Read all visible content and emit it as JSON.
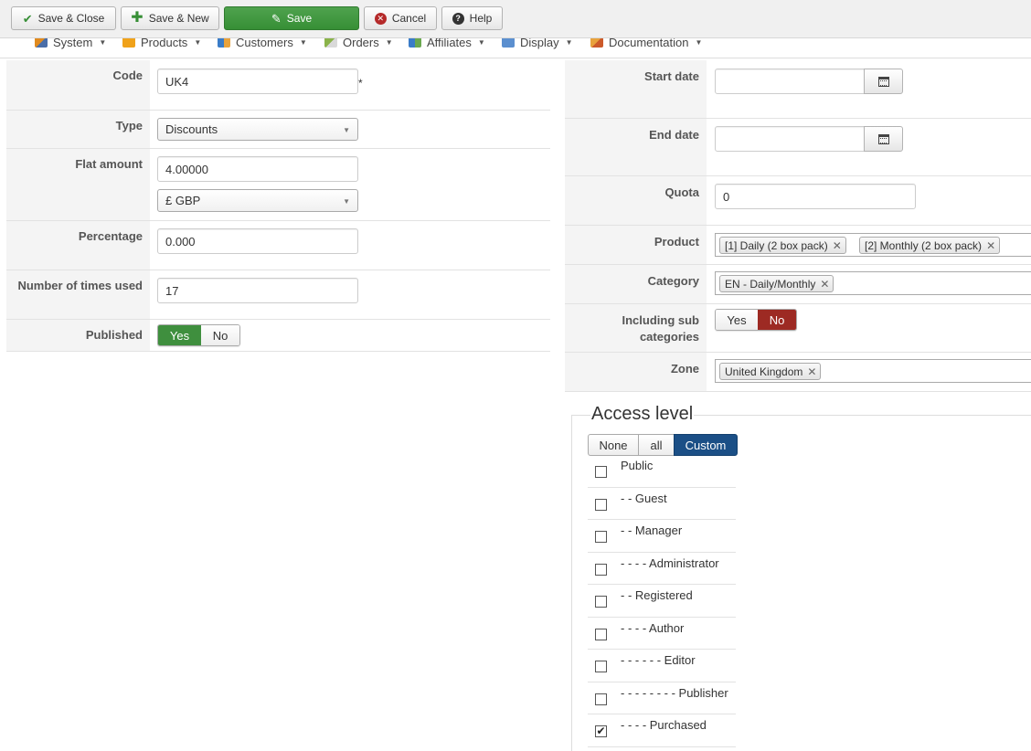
{
  "toolbar": {
    "save_close": "Save & Close",
    "save_new": "Save & New",
    "save": "Save",
    "cancel": "Cancel",
    "help": "Help"
  },
  "menu": {
    "items": [
      {
        "label": "System",
        "icon": "wrench-icon"
      },
      {
        "label": "Products",
        "icon": "box-icon"
      },
      {
        "label": "Customers",
        "icon": "users-icon"
      },
      {
        "label": "Orders",
        "icon": "orders-icon"
      },
      {
        "label": "Affiliates",
        "icon": "affiliates-icon"
      },
      {
        "label": "Display",
        "icon": "display-icon"
      },
      {
        "label": "Documentation",
        "icon": "documentation-icon"
      }
    ]
  },
  "form_left": {
    "code_label": "Code",
    "code_value": "UK4",
    "required_mark": "*",
    "type_label": "Type",
    "type_value": "Discounts",
    "flat_amount_label": "Flat amount",
    "flat_amount_value": "4.00000",
    "currency_value": "£ GBP",
    "percentage_label": "Percentage",
    "percentage_value": "0.000",
    "times_used_label": "Number of times used",
    "times_used_value": "17",
    "published_label": "Published",
    "yes": "Yes",
    "no": "No",
    "published_selected": "Yes"
  },
  "form_right": {
    "start_date_label": "Start date",
    "start_date_value": "",
    "end_date_label": "End date",
    "end_date_value": "",
    "quota_label": "Quota",
    "quota_value": "0",
    "product_label": "Product",
    "products": [
      "[1] Daily (2 box pack)",
      "[2] Monthly (2 box pack)"
    ],
    "category_label": "Category",
    "categories": [
      "EN - Daily/Monthly"
    ],
    "including_sub_label_1": "Including sub",
    "including_sub_label_2": "categories",
    "yes": "Yes",
    "no": "No",
    "including_sub_selected": "No",
    "zone_label": "Zone",
    "zones": [
      "United Kingdom"
    ]
  },
  "access": {
    "legend": "Access level",
    "none": "None",
    "all": "all",
    "custom": "Custom",
    "selected_mode": "Custom",
    "levels": [
      {
        "label": "Public",
        "checked": false
      },
      {
        "label": "- - Guest",
        "checked": false
      },
      {
        "label": "- - Manager",
        "checked": false
      },
      {
        "label": "- - - - Administrator",
        "checked": false
      },
      {
        "label": "- - Registered",
        "checked": false
      },
      {
        "label": "- - - - Author",
        "checked": false
      },
      {
        "label": "- - - - - - Editor",
        "checked": false
      },
      {
        "label": "- - - - - - - - Publisher",
        "checked": false
      },
      {
        "label": "- - - - Purchased",
        "checked": true
      }
    ]
  },
  "colors": {
    "save_green": "#378f36",
    "yes_green": "#3f8f3e",
    "no_red": "#9d2a23",
    "custom_blue": "#1b4f86"
  }
}
